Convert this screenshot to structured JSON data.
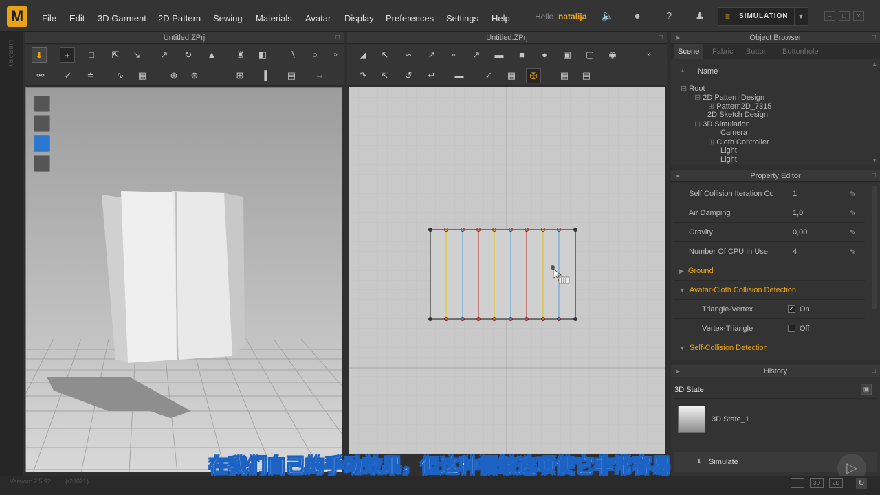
{
  "app": {
    "logo": "M"
  },
  "menu": [
    "File",
    "Edit",
    "3D Garment",
    "2D Pattern",
    "Sewing",
    "Materials",
    "Avatar",
    "Display",
    "Preferences",
    "Settings",
    "Help"
  ],
  "user": {
    "greeting": "Hello,",
    "name": "natalija"
  },
  "mode": {
    "label": "SIMULATION"
  },
  "library_strip": {
    "label": "LIBRARY"
  },
  "panel3d": {
    "title": "Untitled.ZPrj"
  },
  "panel2d": {
    "title": "Untitled.ZPrj"
  },
  "object_browser": {
    "title": "Object Browser",
    "tabs": [
      "Scene",
      "Fabric",
      "Button",
      "Buttonhole"
    ],
    "column": "Name",
    "tree": [
      "Root",
      "2D Pattern Design",
      "Pattern2D_7315",
      "2D Sketch Design",
      "3D Simulation",
      "Camera",
      "Cloth Controller",
      "Light",
      "Light"
    ]
  },
  "property_editor": {
    "title": "Property Editor",
    "rows": [
      {
        "name": "Self Collision Iteration Count",
        "value": "1"
      },
      {
        "name": "Air Damping",
        "value": "1,0"
      },
      {
        "name": "Gravity",
        "value": "0,00"
      },
      {
        "name": "Number Of CPU In Use",
        "value": "4"
      }
    ],
    "sections": [
      "Ground",
      "Avatar-Cloth Collision Detection",
      "Self-Collision Detection"
    ],
    "checks": [
      {
        "name": "Triangle-Vertex",
        "state": "On",
        "checked": true
      },
      {
        "name": "Vertex-Triangle",
        "state": "Off",
        "checked": false
      }
    ]
  },
  "history": {
    "title": "History",
    "state_label": "3D State",
    "item": "3D State_1",
    "action": "Simulate"
  },
  "status": {
    "version": "Version: 2.5.92",
    "build": "(r23021)"
  },
  "subtitle": "在我们自己的手动效果，但这种褶皱选项使它非常容易",
  "colors": {
    "accent": "#e8a317",
    "line_yellow": "#e8c800",
    "line_blue": "#4aa0e0",
    "line_red": "#b02020"
  }
}
